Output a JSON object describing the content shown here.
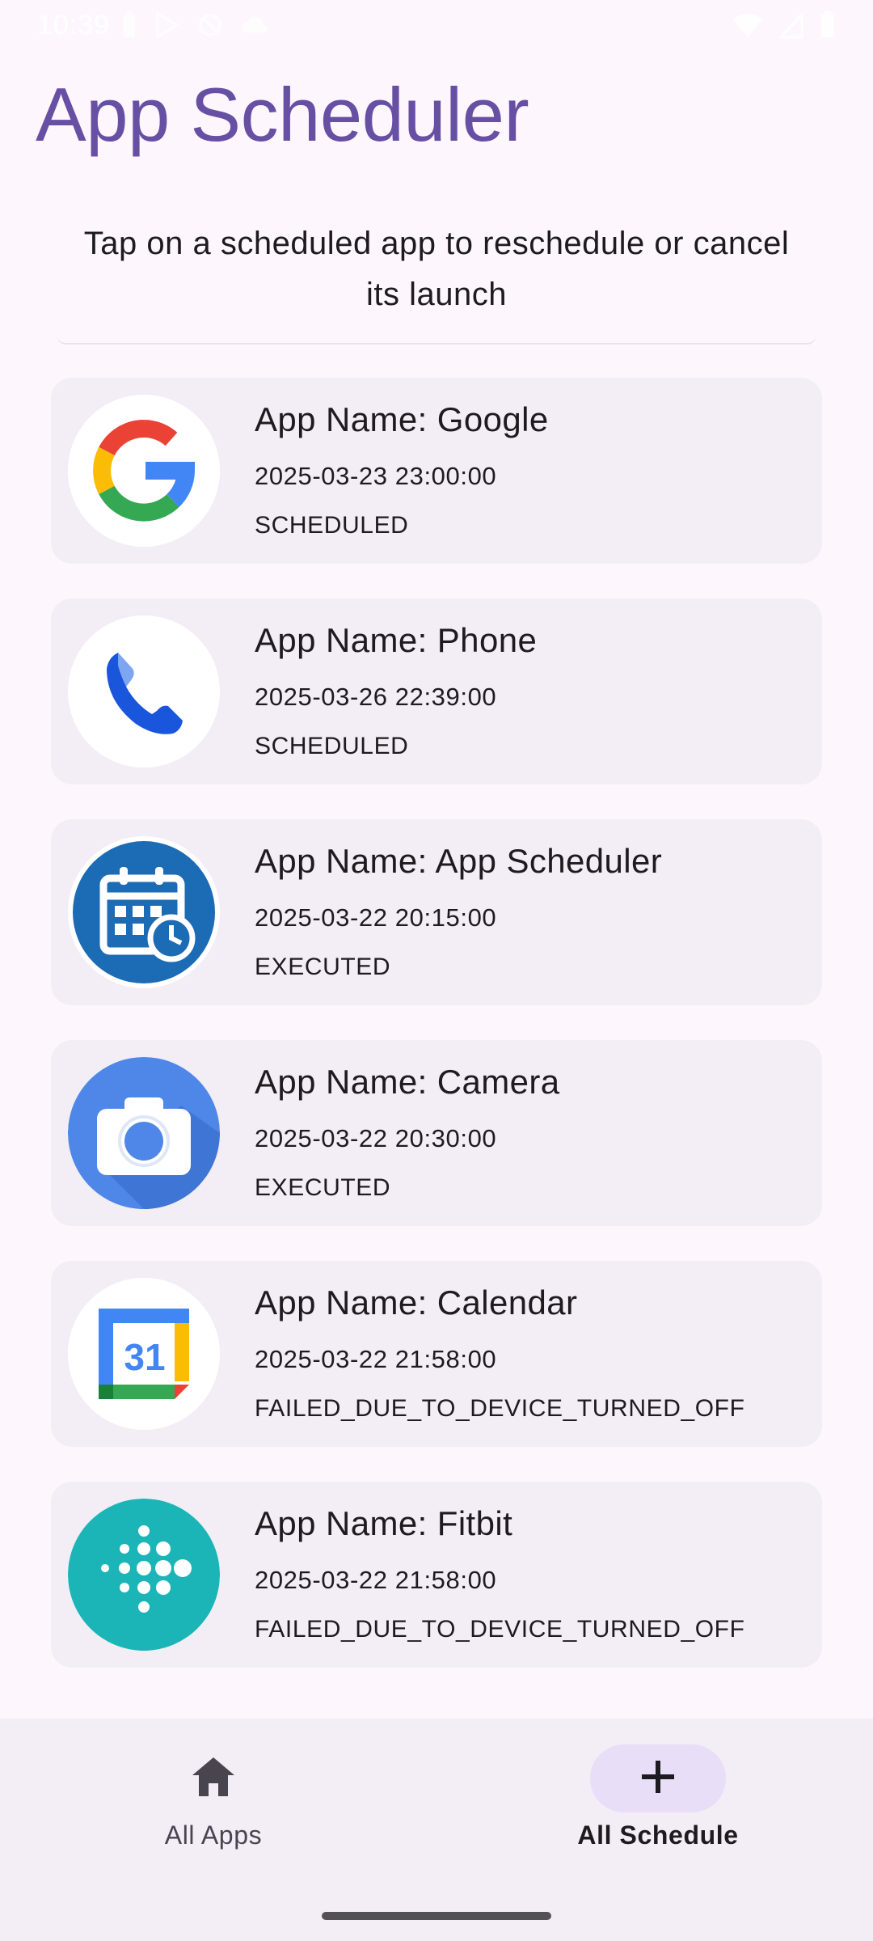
{
  "status_bar": {
    "time": "10:39",
    "icons": [
      "battery-saver-icon",
      "play-store-icon",
      "do-not-disturb-icon",
      "cloud-icon",
      "wifi-icon",
      "signal-icon",
      "battery-icon"
    ]
  },
  "header": {
    "title": "App Scheduler",
    "subtitle": "Tap on a scheduled app to reschedule or cancel its launch"
  },
  "schedules": [
    {
      "name": "App Name: Google",
      "datetime": "2025-03-23 23:00:00",
      "status": "SCHEDULED",
      "icon": "google-icon"
    },
    {
      "name": "App Name: Phone",
      "datetime": "2025-03-26 22:39:00",
      "status": "SCHEDULED",
      "icon": "phone-icon"
    },
    {
      "name": "App Name: App Scheduler",
      "datetime": "2025-03-22 20:15:00",
      "status": "EXECUTED",
      "icon": "app-scheduler-icon"
    },
    {
      "name": "App Name: Camera",
      "datetime": "2025-03-22 20:30:00",
      "status": "EXECUTED",
      "icon": "camera-icon"
    },
    {
      "name": "App Name: Calendar",
      "datetime": "2025-03-22 21:58:00",
      "status": "FAILED_DUE_TO_DEVICE_TURNED_OFF",
      "icon": "calendar-icon",
      "icon_text": "31"
    },
    {
      "name": "App Name: Fitbit",
      "datetime": "2025-03-22 21:58:00",
      "status": "FAILED_DUE_TO_DEVICE_TURNED_OFF",
      "icon": "fitbit-icon"
    }
  ],
  "bottom_nav": {
    "items": [
      {
        "label": "All Apps",
        "icon": "home-icon",
        "selected": false
      },
      {
        "label": "All Schedule",
        "icon": "plus-icon",
        "selected": true
      }
    ]
  },
  "colors": {
    "accent": "#6750a4",
    "card": "#f3edf6",
    "nav_indicator": "#e8def8",
    "background": "#fdf7fd"
  }
}
